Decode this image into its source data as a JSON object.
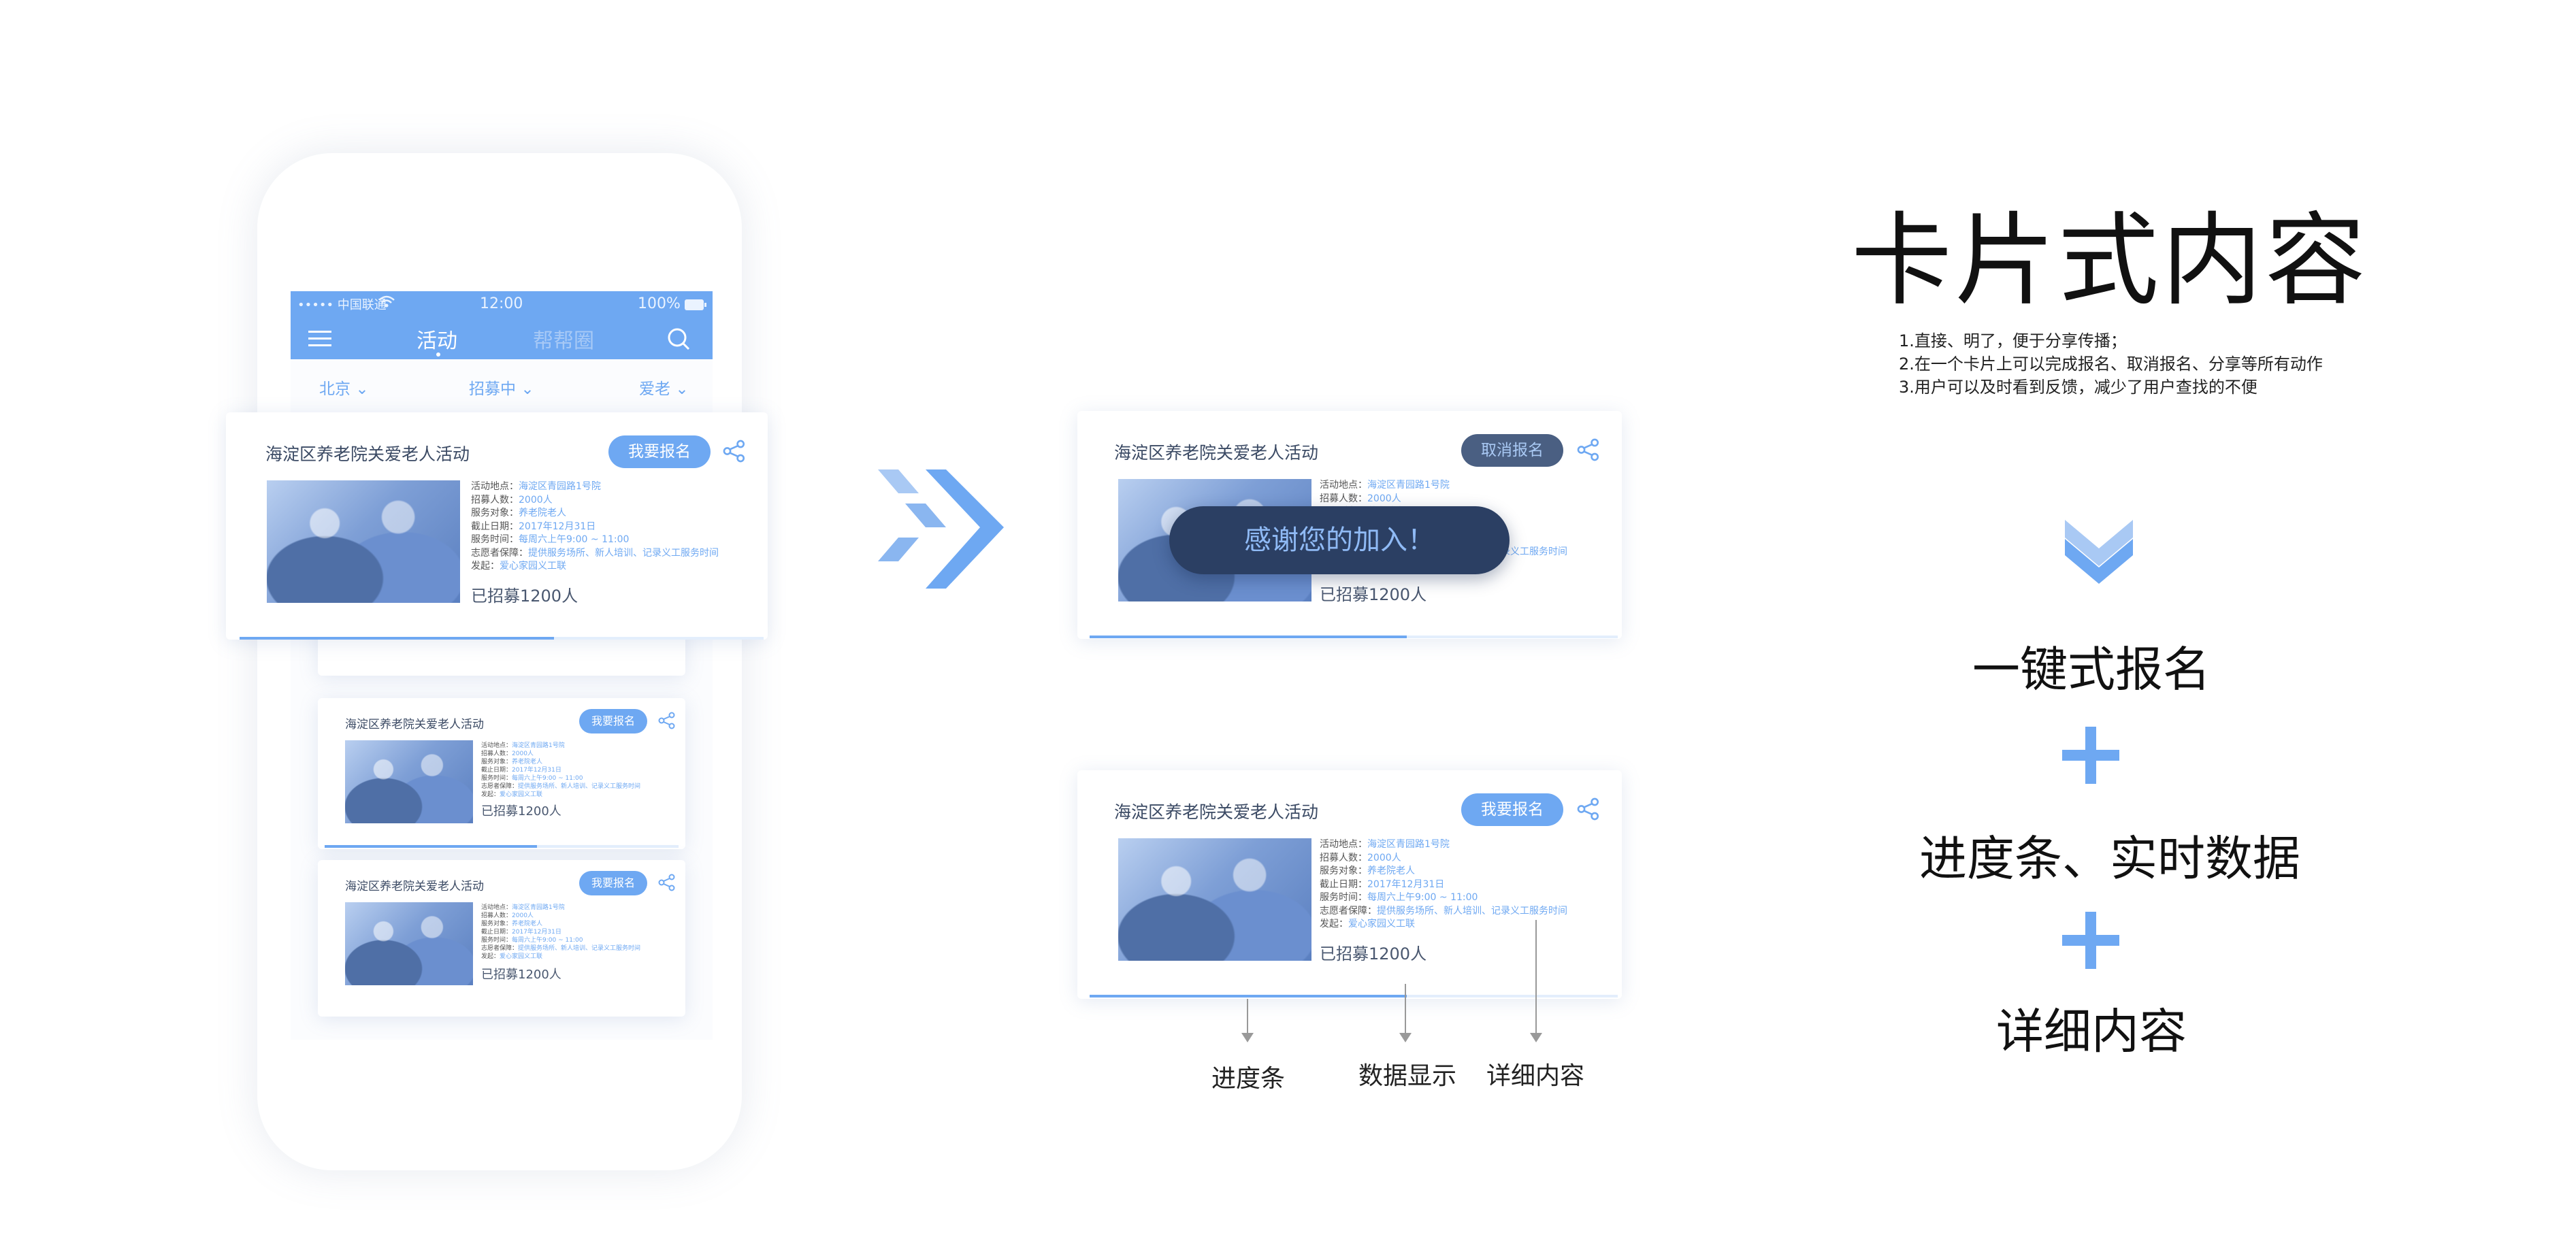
{
  "phone": {
    "status": {
      "carrier": "••••• 中国联通",
      "time": "12:00",
      "battery": "100%"
    },
    "tabs": [
      {
        "label": "活动",
        "active": true
      },
      {
        "label": "帮帮圈",
        "active": false
      }
    ],
    "filters": [
      "北京",
      "招募中",
      "爱老"
    ]
  },
  "card": {
    "title": "海淀区养老院关爱老人活动",
    "signup_label": "我要报名",
    "cancel_label": "取消报名",
    "details": [
      {
        "key": "活动地点：",
        "value": "海淀区青园路1号院"
      },
      {
        "key": "招募人数：",
        "value": "2000人"
      },
      {
        "key": "服务对象：",
        "value": "养老院老人"
      },
      {
        "key": "截止日期：",
        "value": "2017年12月31日"
      },
      {
        "key": "服务时间：",
        "value": "每周六上午9:00 ~ 11:00"
      },
      {
        "key": "志愿者保障：",
        "value": "提供服务场所、新人培训、记录义工服务时间"
      },
      {
        "key": "发起：",
        "value": "爱心家园义工联"
      }
    ],
    "recruited": "已招募1200人",
    "progress": 0.6
  },
  "toast": {
    "message": "感谢您的加入！"
  },
  "annotations": {
    "progress_bar": "进度条",
    "data_display": "数据显示",
    "detail_content": "详细内容"
  },
  "right": {
    "title": "卡片式内容",
    "notes": [
      "1.直接、明了，便于分享传播；",
      "2.在一个卡片上可以完成报名、取消报名、分享等所有动作",
      "3.用户可以及时看到反馈，减少了用户查找的不便"
    ],
    "features": [
      "一键式报名",
      "进度条、实时数据",
      "详细内容"
    ]
  },
  "colors": {
    "accent": "#6ea8f2",
    "dark_pill": "#4a5f82",
    "toast_bg": "#2b3f63",
    "toast_text": "#8fbaf5"
  },
  "icons": [
    "menu-icon",
    "search-icon",
    "chevron-down-icon",
    "share-icon",
    "double-chevron-right-icon",
    "double-chevron-down-icon",
    "plus-icon"
  ]
}
